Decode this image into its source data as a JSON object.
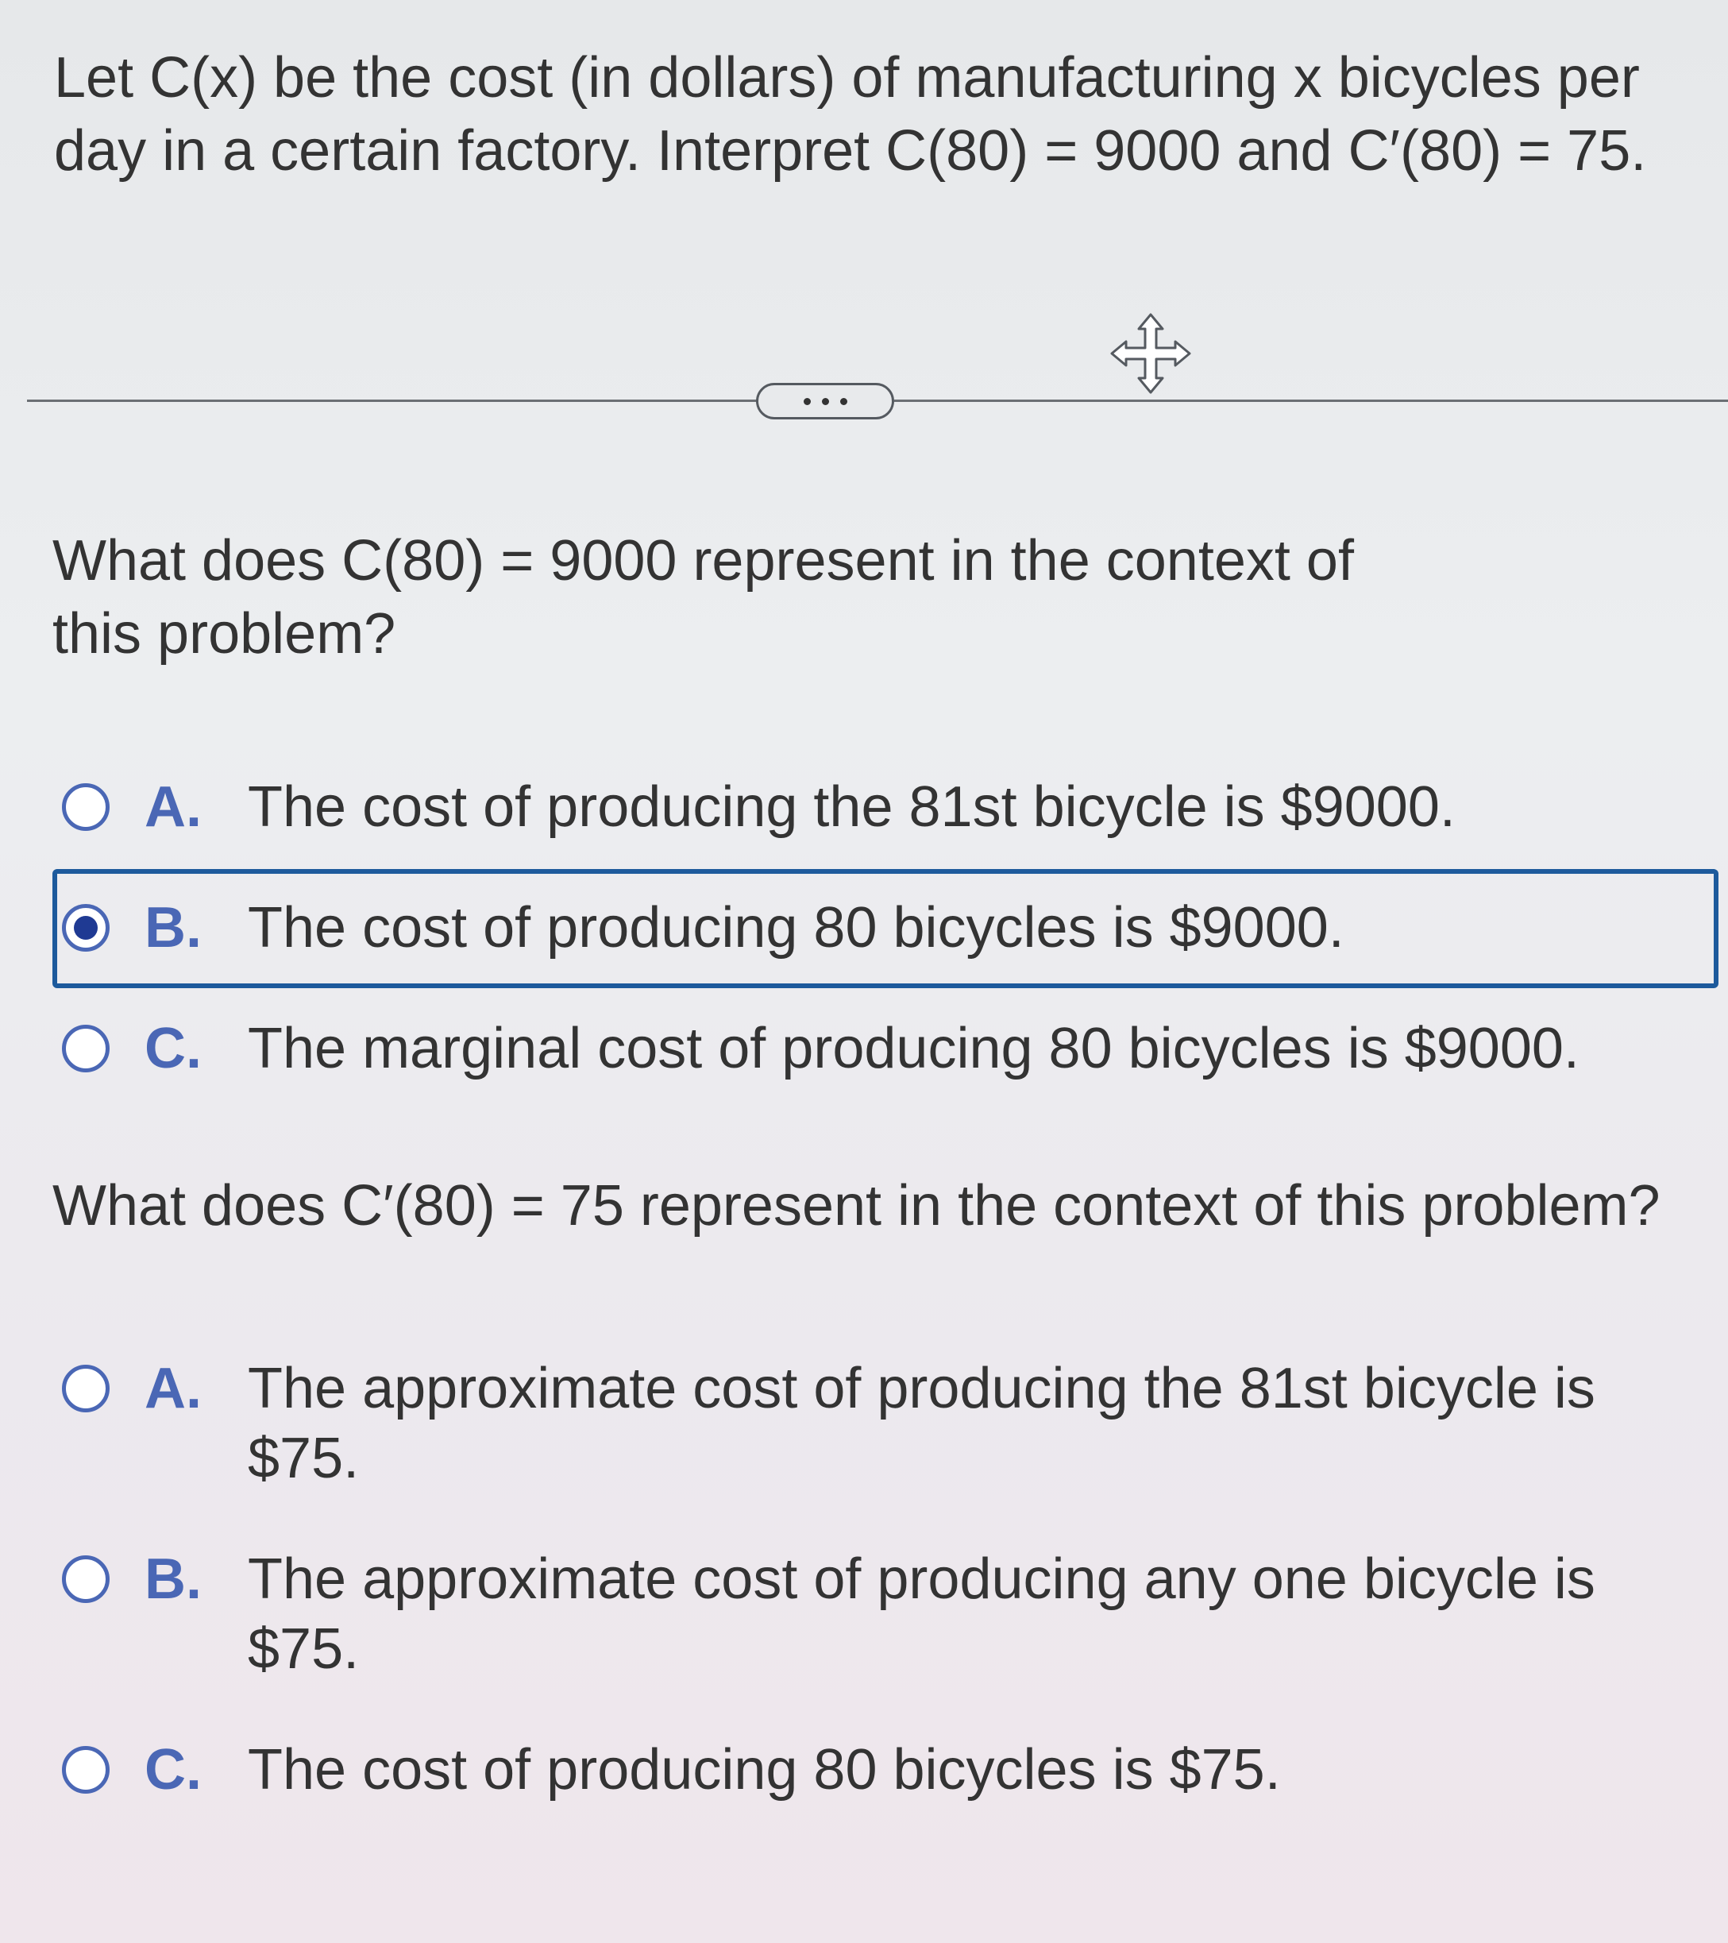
{
  "problem": {
    "statement": "Let C(x) be the cost (in dollars) of manufacturing x bicycles per day in a certain factory. Interpret C(80) = 9000 and C′(80) = 75."
  },
  "toolbar": {
    "more_icon": "more-dots-icon",
    "move_icon": "move-arrows-icon"
  },
  "part1": {
    "question": "What does C(80) = 9000 represent in the context of this problem?",
    "selected": "B",
    "choices": [
      {
        "letter": "A.",
        "text": "The cost of producing the 81st bicycle is $9000."
      },
      {
        "letter": "B.",
        "text": "The cost of producing 80 bicycles is $9000."
      },
      {
        "letter": "C.",
        "text": "The marginal cost of producing 80 bicycles is $9000."
      }
    ]
  },
  "part2": {
    "question": "What does C′(80) = 75 represent in the context of this problem?",
    "selected": null,
    "choices": [
      {
        "letter": "A.",
        "text": "The approximate cost of producing the 81st bicycle is $75."
      },
      {
        "letter": "B.",
        "text": "The approximate cost of producing any one bicycle is $75."
      },
      {
        "letter": "C.",
        "text": "The cost of producing 80 bicycles is $75."
      }
    ]
  },
  "colors": {
    "accent": "#4a67b5",
    "selected_frame": "#1d5a9c",
    "text": "#333333"
  }
}
